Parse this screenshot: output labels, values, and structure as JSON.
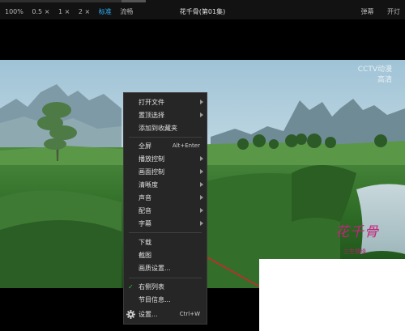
{
  "toolbar": {
    "zoom_options": [
      "100%",
      "0.5 ×",
      "1 ×",
      "2 ×"
    ],
    "quality_standard": "标准",
    "quality_smooth": "流畅",
    "title": "花千骨(第01集)",
    "danmu": "弹幕",
    "lights": "开灯"
  },
  "video": {
    "watermark_top": "CCTV动漫",
    "watermark_sub": "高清",
    "logo_title": "花千骨",
    "logo_subtitle": "三生情缘"
  },
  "context_menu": {
    "open_file": "打开文件",
    "pin_top": "置顶选择",
    "add_favorite": "添加到收藏夹",
    "fullscreen": "全屏",
    "fullscreen_shortcut": "Alt+Enter",
    "playback_control": "播放控制",
    "picture_control": "画面控制",
    "clarity": "清晰度",
    "sound": "声音",
    "dubbing": "配音",
    "subtitle": "字幕",
    "download": "下载",
    "screenshot": "截图",
    "picture_settings": "画质设置...",
    "right_list": "右侧列表",
    "program_info": "节目信息...",
    "settings": "设置...",
    "settings_shortcut": "Ctrl+W"
  },
  "colors": {
    "accent": "#2fb6ff",
    "check": "#27c32b",
    "annotation_arrow": "#d8232a",
    "logo": "#c4247a"
  }
}
